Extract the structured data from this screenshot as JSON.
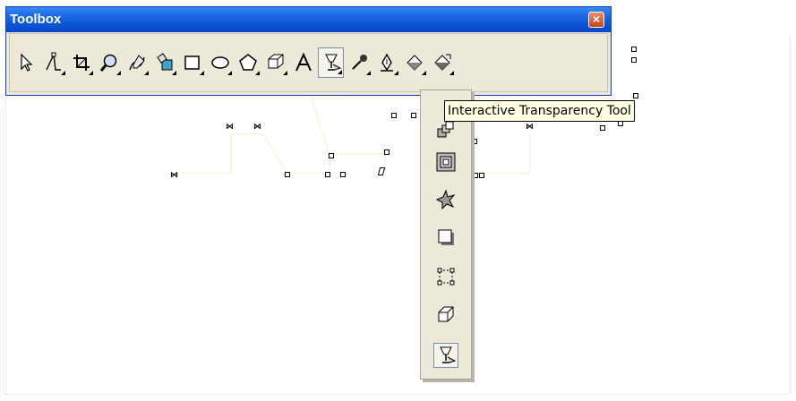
{
  "window": {
    "title": "Toolbox",
    "close_label": "×"
  },
  "tools": [
    {
      "name": "pick-tool-icon",
      "flyout": false
    },
    {
      "name": "shape-tool-icon",
      "flyout": true
    },
    {
      "name": "crop-tool-icon",
      "flyout": true
    },
    {
      "name": "zoom-tool-icon",
      "flyout": true
    },
    {
      "name": "freehand-tool-icon",
      "flyout": true
    },
    {
      "name": "smart-fill-tool-icon",
      "flyout": true
    },
    {
      "name": "rectangle-tool-icon",
      "flyout": true
    },
    {
      "name": "ellipse-tool-icon",
      "flyout": true
    },
    {
      "name": "polygon-tool-icon",
      "flyout": true
    },
    {
      "name": "basic-shapes-tool-icon",
      "flyout": true
    },
    {
      "name": "text-tool-icon",
      "flyout": false
    },
    {
      "name": "interactive-transparency-tool-icon",
      "flyout": true,
      "active": true
    },
    {
      "name": "eyedropper-tool-icon",
      "flyout": true
    },
    {
      "name": "outline-pen-tool-icon",
      "flyout": true
    },
    {
      "name": "fill-tool-icon",
      "flyout": true
    },
    {
      "name": "interactive-fill-tool-icon",
      "flyout": true
    }
  ],
  "flyout_tools": [
    "interactive-blend-tool-icon",
    "interactive-contour-tool-icon",
    "interactive-distortion-tool-icon",
    "interactive-drop-shadow-tool-icon",
    "interactive-envelope-tool-icon",
    "interactive-extrude-tool-icon",
    "interactive-transparency-tool-icon"
  ],
  "tooltip": {
    "text": "Interactive Transparency Tool"
  },
  "colors": {
    "titlebar": "#0b55d6",
    "panel": "#ece9d8",
    "tooltip_bg": "#ffffe1"
  }
}
